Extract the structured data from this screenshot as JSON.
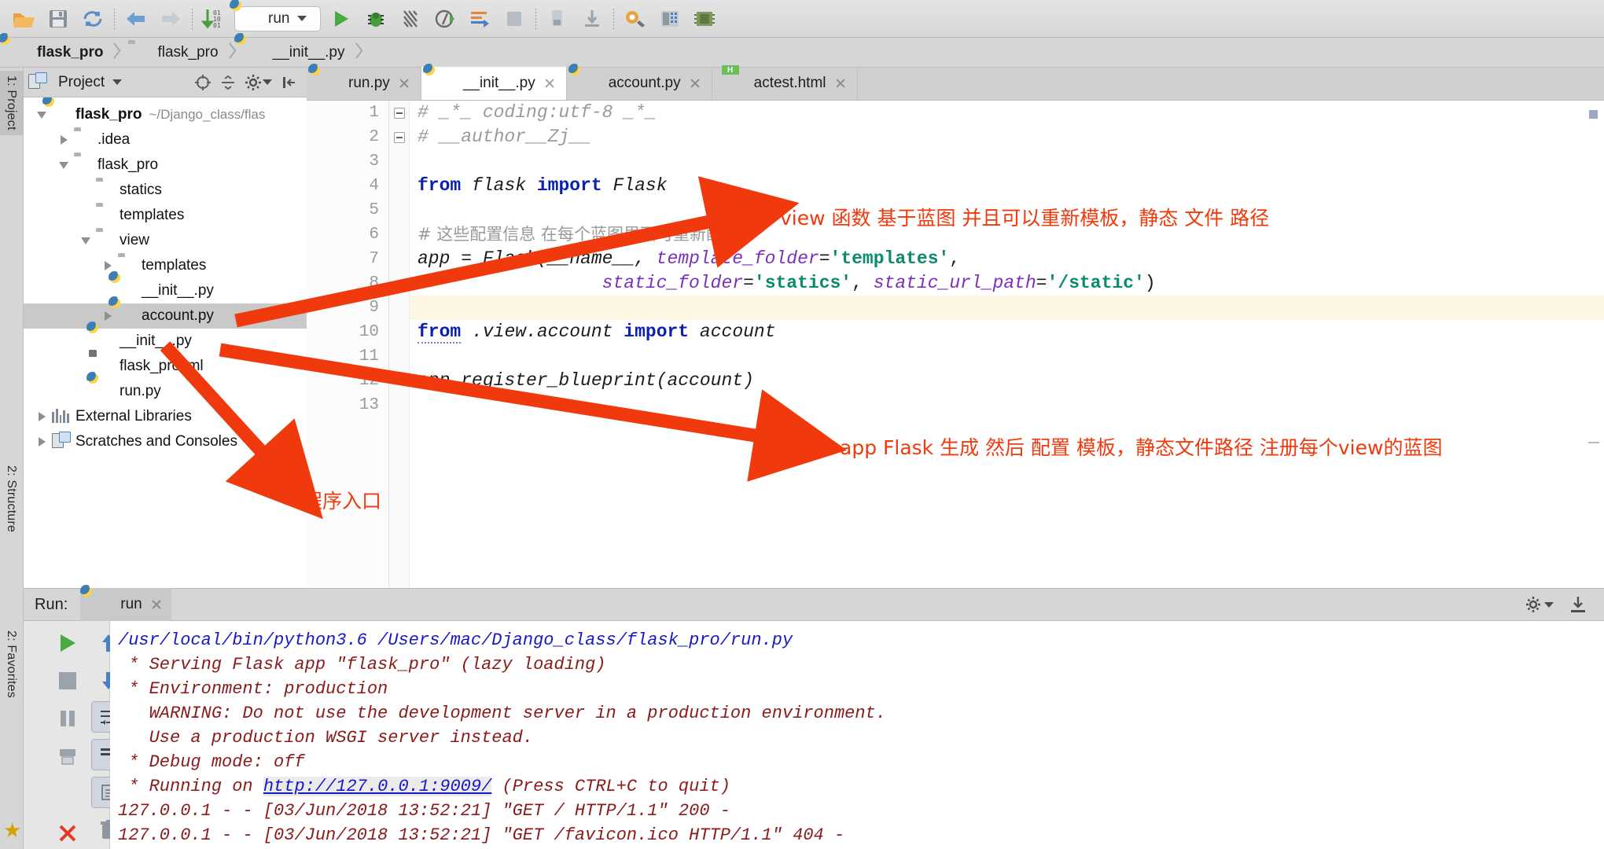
{
  "toolbar": {
    "icons": [
      "open-folder-icon",
      "save-all-icon",
      "sync-icon",
      "back-arrow-icon",
      "forward-arrow-icon",
      "sort-numeric-icon"
    ],
    "run_config": {
      "label": "run",
      "icon": "python-file-icon"
    },
    "right_icons": [
      "run-icon",
      "debug-icon",
      "coverage-icon",
      "profile-icon",
      "attach-icon",
      "stop-icon",
      "deploy-icon",
      "download-icon",
      "settings-wrench-icon",
      "database-icon",
      "memory-icon"
    ]
  },
  "breadcrumb": {
    "items": [
      {
        "label": "flask_pro",
        "icon": "python-project-icon",
        "bold": true
      },
      {
        "label": "flask_pro",
        "icon": "folder-icon",
        "bold": false
      },
      {
        "label": "__init__.py",
        "icon": "python-file-icon",
        "bold": false
      }
    ]
  },
  "left_strip": {
    "tabs": [
      {
        "label": "1: Project",
        "selected": true
      },
      {
        "label": "2: Structure",
        "selected": false
      },
      {
        "label": "2: Favorites",
        "selected": false
      }
    ]
  },
  "project_panel": {
    "title": "Project",
    "header_icons": [
      "target-icon",
      "collapse-all-icon",
      "gear-icon",
      "hide-icon"
    ],
    "tree": [
      {
        "depth": 0,
        "twisty": "down",
        "icon": "python-project-icon",
        "label": "flask_pro",
        "bold": true,
        "path": "~/Django_class/flas",
        "selected": false
      },
      {
        "depth": 1,
        "twisty": "right",
        "icon": "folder-icon",
        "label": ".idea",
        "bold": false,
        "path": "",
        "selected": false
      },
      {
        "depth": 1,
        "twisty": "down",
        "icon": "folder-icon",
        "label": "flask_pro",
        "bold": false,
        "path": "",
        "selected": false
      },
      {
        "depth": 2,
        "twisty": "none",
        "icon": "folder-icon",
        "label": "statics",
        "bold": false,
        "path": "",
        "selected": false
      },
      {
        "depth": 2,
        "twisty": "none",
        "icon": "folder-icon",
        "label": "templates",
        "bold": false,
        "path": "",
        "selected": false
      },
      {
        "depth": 2,
        "twisty": "down",
        "icon": "folder-icon",
        "label": "view",
        "bold": false,
        "path": "",
        "selected": false
      },
      {
        "depth": 3,
        "twisty": "right",
        "icon": "folder-icon",
        "label": "templates",
        "bold": false,
        "path": "",
        "selected": false
      },
      {
        "depth": 3,
        "twisty": "none",
        "icon": "python-file-icon",
        "label": "__init__.py",
        "bold": false,
        "path": "",
        "selected": false
      },
      {
        "depth": 3,
        "twisty": "right",
        "icon": "python-file-icon",
        "label": "account.py",
        "bold": false,
        "path": "",
        "selected": true
      },
      {
        "depth": 2,
        "twisty": "none",
        "icon": "python-file-icon",
        "label": "__init__.py",
        "bold": false,
        "path": "",
        "selected": false
      },
      {
        "depth": 2,
        "twisty": "none",
        "icon": "iml-file-icon",
        "label": "flask_pro.iml",
        "bold": false,
        "path": "",
        "selected": false
      },
      {
        "depth": 2,
        "twisty": "none",
        "icon": "python-file-icon",
        "label": "run.py",
        "bold": false,
        "path": "",
        "selected": false
      },
      {
        "depth": 0,
        "twisty": "right",
        "icon": "libraries-icon",
        "label": "External Libraries",
        "bold": false,
        "path": "",
        "selected": false
      },
      {
        "depth": 0,
        "twisty": "right",
        "icon": "scratches-icon",
        "label": "Scratches and Consoles",
        "bold": false,
        "path": "",
        "selected": false
      }
    ]
  },
  "editor_tabs": [
    {
      "label": "run.py",
      "icon": "python-file-icon",
      "active": false
    },
    {
      "label": "__init__.py",
      "icon": "python-file-icon",
      "active": true
    },
    {
      "label": "account.py",
      "icon": "python-file-icon",
      "active": false
    },
    {
      "label": "actest.html",
      "icon": "html-file-icon",
      "active": false
    }
  ],
  "editor": {
    "line_numbers": [
      "1",
      "2",
      "3",
      "4",
      "5",
      "6",
      "7",
      "8",
      "9",
      "10",
      "11",
      "12",
      "13"
    ],
    "lines": [
      {
        "n": 1,
        "highlight": false
      },
      {
        "n": 2,
        "highlight": false
      },
      {
        "n": 3,
        "highlight": false
      },
      {
        "n": 4,
        "highlight": false
      },
      {
        "n": 5,
        "highlight": false
      },
      {
        "n": 6,
        "highlight": false
      },
      {
        "n": 7,
        "highlight": false
      },
      {
        "n": 8,
        "highlight": false
      },
      {
        "n": 9,
        "highlight": true
      },
      {
        "n": 10,
        "highlight": false
      },
      {
        "n": 11,
        "highlight": false
      },
      {
        "n": 12,
        "highlight": false
      },
      {
        "n": 13,
        "highlight": false
      }
    ],
    "text": {
      "l1": "# _*_ coding:utf-8 _*_",
      "l2": "# __author__Zj__",
      "l4_from": "from",
      "l4_flask": "flask",
      "l4_import": "import",
      "l4_Flask": "Flask",
      "l6": "# 这些配置信息 在每个蓝图里面可重新配置",
      "l7_app": "app = Flask(__name__, ",
      "l7_kw": "template_folder",
      "l7_eq": "=",
      "l7_val": "'templates'",
      "l7_end": ",",
      "l8_kw1": "static_folder",
      "l8_val1": "'statics'",
      "l8_kw2": "static_url_path",
      "l8_val2": "'/static'",
      "l8_end": ")",
      "l10_from": "from",
      "l10_mod": ".view.account",
      "l10_import": "import",
      "l10_name": "account",
      "l12": "app.register_blueprint(account)"
    }
  },
  "annotations": [
    {
      "id": "a1",
      "text": "view 函数 基于蓝图 并且可以重新模板，静态 文件 路径"
    },
    {
      "id": "a2",
      "text": "app Flask 生成 然后 配置 模板，静态文件路径 注册每个view的蓝图"
    },
    {
      "id": "a3",
      "text": "程序入口"
    }
  ],
  "run_panel": {
    "label": "Run:",
    "tab": {
      "label": "run",
      "icon": "python-file-icon"
    },
    "header_icons": [
      "gear-icon",
      "export-icon"
    ],
    "side_buttons": [
      "rerun-icon",
      "up-arrow-icon",
      "down-arrow-icon",
      "stop-icon",
      "pause-icon",
      "soft-wrap-icon",
      "scroll-to-end-icon",
      "print-icon",
      "trash-icon",
      "close-icon"
    ],
    "console_lines": [
      {
        "text": "/usr/local/bin/python3.6 /Users/mac/Django_class/flask_pro/run.py",
        "color": "blue",
        "link": ""
      },
      {
        "text": " * Serving Flask app \"flask_pro\" (lazy loading)",
        "color": "red",
        "link": ""
      },
      {
        "text": " * Environment: production",
        "color": "red",
        "link": ""
      },
      {
        "text": "   WARNING: Do not use the development server in a production environment.",
        "color": "red",
        "link": ""
      },
      {
        "text": "   Use a production WSGI server instead.",
        "color": "red",
        "link": ""
      },
      {
        "text": " * Debug mode: off",
        "color": "red",
        "link": ""
      },
      {
        "pre": " * Running on ",
        "link": "http://127.0.0.1:9009/",
        "post": " (Press CTRL+C to quit)",
        "color": "red"
      },
      {
        "text": "127.0.0.1 - - [03/Jun/2018 13:52:21] \"GET / HTTP/1.1\" 200 -",
        "color": "red",
        "link": ""
      },
      {
        "text": "127.0.0.1 - - [03/Jun/2018 13:52:21] \"GET /favicon.ico HTTP/1.1\" 404 -",
        "color": "red",
        "link": ""
      }
    ]
  },
  "colors": {
    "annotation": "#f0390c",
    "keyword": "#0a21b0",
    "string": "#0a8a6e",
    "kwarg": "#7b2fbe",
    "comment": "#9a9a9a",
    "console_red": "#8b1a1a",
    "console_blue": "#1818c8"
  }
}
